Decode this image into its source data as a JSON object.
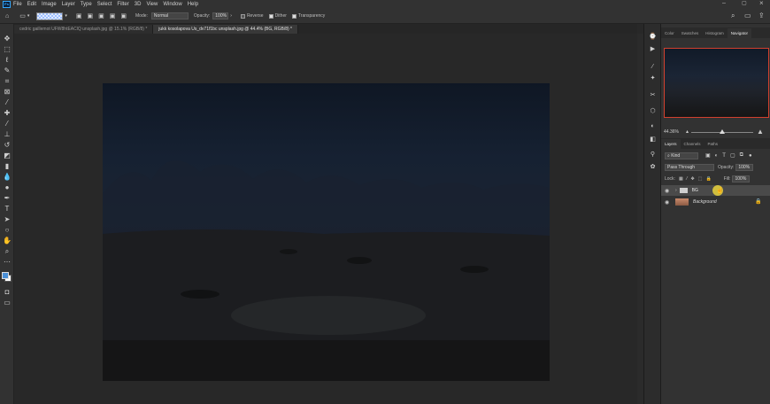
{
  "menubar": {
    "app_badge": "Ps",
    "items": [
      "File",
      "Edit",
      "Image",
      "Layer",
      "Type",
      "Select",
      "Filter",
      "3D",
      "View",
      "Window",
      "Help"
    ]
  },
  "options": {
    "mode_label": "Mode:",
    "mode_value": "Normal",
    "opacity_label": "Opacity:",
    "opacity_value": "100%",
    "reverse_label": "Reverse",
    "dither_label": "Dither",
    "transparency_label": "Transparency"
  },
  "tabs": [
    {
      "label": "cedric gaillemot UFW8htEAClQ unsplash.jpg @ 15.1% (RGB/8) *",
      "active": false
    },
    {
      "label": "jukk kosolapova Us_dv71f1bc unsplash.jpg @ 44.4% (BG, RGB/8) *",
      "active": true
    }
  ],
  "panel_tabs": [
    "Color",
    "Swatches",
    "Histogram",
    "Navigator"
  ],
  "navigator": {
    "zoom": "44.36%"
  },
  "layers_panel": {
    "tabs": [
      "Layers",
      "Channels",
      "Paths"
    ],
    "filter_label": "Kind",
    "blend_mode": "Pass Through",
    "opacity_label": "Opacity:",
    "opacity_value": "100%",
    "lock_label": "Lock:",
    "fill_label": "Fill:",
    "fill_value": "100%",
    "layers": [
      {
        "name": "BG",
        "type": "group",
        "selected": true
      },
      {
        "name": "Background",
        "type": "image",
        "locked": true
      }
    ]
  },
  "colors": {
    "foreground": "#4a8fd6",
    "background": "#ffffff",
    "nav_frame": "#d2402e"
  }
}
